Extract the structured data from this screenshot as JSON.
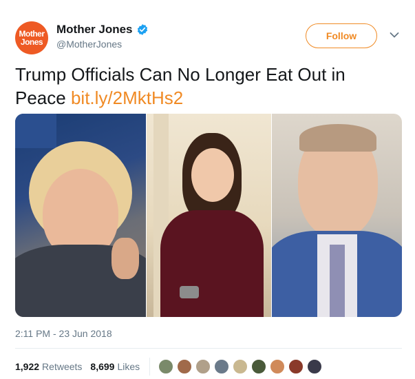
{
  "account": {
    "avatar_line1": "Mother",
    "avatar_line2": "Jones",
    "display_name": "Mother Jones",
    "handle": "@MotherJones",
    "follow_label": "Follow"
  },
  "tweet": {
    "text": "Trump Officials Can No Longer Eat Out in Peace ",
    "link": "bit.ly/2MktHs2",
    "timestamp": "2:11 PM - 23 Jun 2018"
  },
  "stats": {
    "retweets_count": "1,922",
    "retweets_label": "Retweets",
    "likes_count": "8,699",
    "likes_label": "Likes"
  },
  "likers": [
    {
      "name": "liker-1",
      "color": "#7a8a6a"
    },
    {
      "name": "liker-2",
      "color": "#a06a4a"
    },
    {
      "name": "liker-3",
      "color": "#b0a08a"
    },
    {
      "name": "liker-4",
      "color": "#6a7a8a"
    },
    {
      "name": "liker-5",
      "color": "#c9b890"
    },
    {
      "name": "liker-6",
      "color": "#4a5a3a"
    },
    {
      "name": "liker-7",
      "color": "#d08a5a"
    },
    {
      "name": "liker-8",
      "color": "#8a3a2a"
    },
    {
      "name": "liker-9",
      "color": "#3a3a4a"
    }
  ],
  "colors": {
    "accent": "#f08a24",
    "verified": "#1da1f2",
    "secondary_text": "#657786"
  }
}
